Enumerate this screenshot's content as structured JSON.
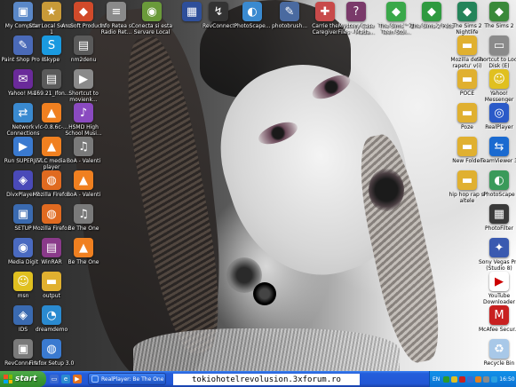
{
  "desktop": {
    "icons": [
      {
        "label": "My Computer",
        "color": "#5a88c8",
        "glyph": "▣"
      },
      {
        "label": "Star Local Server 1",
        "color": "#c89a38",
        "glyph": "★"
      },
      {
        "label": "ArcSoft Products",
        "color": "#d14a2a",
        "glyph": "◆"
      },
      {
        "label": "Info Retea si Radio Ret...",
        "color": "#8a8a8a",
        "glyph": "≡"
      },
      {
        "label": "Conecta si esta Servare Local",
        "color": "#6a9a3a",
        "glyph": "◉"
      },
      {
        "label": "",
        "color": "#2e4f9a",
        "glyph": "▦"
      },
      {
        "label": "RevConnect",
        "color": "#333333",
        "glyph": "↯"
      },
      {
        "label": "PhotoScape...",
        "color": "#3a8ad0",
        "glyph": "◐"
      },
      {
        "label": "photobrush...",
        "color": "#4a6aa0",
        "glyph": "✎"
      },
      {
        "label": "Carrie the Caregiver",
        "color": "#c84a4a",
        "glyph": "✚"
      },
      {
        "label": "Mystery Case Files - Mada...",
        "color": "#7a3a6a",
        "glyph": "?"
      },
      {
        "label": "The Sims™ 2 Teen Stol...",
        "color": "#3aa84a",
        "glyph": "◆"
      },
      {
        "label": "The Sims 2 Pets",
        "color": "#2f9a40",
        "glyph": "◆"
      },
      {
        "label": "The Sims 2 Nightlife",
        "color": "#24845a",
        "glyph": "◆"
      },
      {
        "label": "The Sims 2",
        "color": "#3a8a3a",
        "glyph": "◆"
      },
      {
        "label": "Paint Shop Pro 8",
        "color": "#4a6ab8",
        "glyph": "✎"
      },
      {
        "label": "Skype",
        "color": "#1a9ae0",
        "glyph": "S"
      },
      {
        "label": "nm2denu",
        "color": "#5a5a5a",
        "glyph": "▤"
      },
      {
        "label": "Mozilla de la rapetu' v(i)",
        "color": "#e0b030",
        "glyph": "▬"
      },
      {
        "label": "Shortcut to Local Disk (E)",
        "color": "#8a8a8a",
        "glyph": "▭"
      },
      {
        "label": "Yahoo! Mail",
        "color": "#6a2a9a",
        "glyph": "✉"
      },
      {
        "label": "169.21_Ifon...",
        "color": "#5a5a5a",
        "glyph": "▤"
      },
      {
        "label": "Shortcut to movienk...",
        "color": "#8a8a8a",
        "glyph": "▶"
      },
      {
        "label": "POCE",
        "color": "#e0b030",
        "glyph": "▬"
      },
      {
        "label": "Yahoo! Messenger",
        "color": "#e0c020",
        "glyph": "☺"
      },
      {
        "label": "Network Connections",
        "color": "#3a8ad0",
        "glyph": "⇄"
      },
      {
        "label": "vlc-0.8.6c-...",
        "color": "#f08020",
        "glyph": "▲"
      },
      {
        "label": "HSMD High School Musi...",
        "color": "#8a4ac0",
        "glyph": "♪"
      },
      {
        "label": "Poze",
        "color": "#e0b030",
        "glyph": "▬"
      },
      {
        "label": "RealPlayer",
        "color": "#2a5ac8",
        "glyph": "◎"
      },
      {
        "label": "Run SUPERJET",
        "color": "#3a7ad0",
        "glyph": "▶"
      },
      {
        "label": "VLC media player",
        "color": "#f08020",
        "glyph": "▲"
      },
      {
        "label": "BoA - Valenti",
        "color": "#7a7a7a",
        "glyph": "♫"
      },
      {
        "label": "New Folder",
        "color": "#e0b030",
        "glyph": "▬"
      },
      {
        "label": "TeamViewer 3",
        "color": "#1a6ad0",
        "glyph": "⇆"
      },
      {
        "label": "DivxPlayer 2",
        "color": "#4a4ab8",
        "glyph": "◈"
      },
      {
        "label": "Mozilla Firefox",
        "color": "#e06a20",
        "glyph": "◍"
      },
      {
        "label": "BoA - Valenti",
        "color": "#f08020",
        "glyph": "▲"
      },
      {
        "label": "hip hop rap si altele",
        "color": "#e0b030",
        "glyph": "▬"
      },
      {
        "label": "PhotoScape",
        "color": "#3a9a5a",
        "glyph": "◐"
      },
      {
        "label": "SETUP",
        "color": "#3a6ab0",
        "glyph": "▣"
      },
      {
        "label": "Mozilla Firefox",
        "color": "#e06a20",
        "glyph": "◍"
      },
      {
        "label": "Be The One",
        "color": "#7a7a7a",
        "glyph": "♫"
      },
      {
        "label": "PhotoFilter",
        "color": "#3a3a3a",
        "glyph": "▦"
      },
      {
        "label": "Media Digit",
        "color": "#4a6ac0",
        "glyph": "◉"
      },
      {
        "label": "WinRAR",
        "color": "#8a3a8a",
        "glyph": "▤"
      },
      {
        "label": "Be The One",
        "color": "#f08020",
        "glyph": "▲"
      },
      {
        "label": "Sony Vegas Pro (Studio 8)",
        "color": "#3a5ab0",
        "glyph": "✦"
      },
      {
        "label": "msn",
        "color": "#e0c020",
        "glyph": "☺"
      },
      {
        "label": "output",
        "color": "#e0b030",
        "glyph": "▬"
      },
      {
        "label": "YouTube Downloader",
        "color": "#ffffff",
        "glyph": "▶"
      },
      {
        "label": "IDS",
        "color": "#3a6ab0",
        "glyph": "◈"
      },
      {
        "label": "dreamdemo",
        "color": "#2a8ad0",
        "glyph": "◔"
      },
      {
        "label": "McAfee Secur...",
        "color": "#c82020",
        "glyph": "M"
      },
      {
        "label": "RevConnect...",
        "color": "#7a7a7a",
        "glyph": "▣"
      },
      {
        "label": "Firefox Setup 3.0",
        "color": "#3a7ad0",
        "glyph": "◍"
      },
      {
        "label": "Recycle Bin",
        "color": "#a8c8e8",
        "glyph": "♻"
      }
    ]
  },
  "taskbar": {
    "start_label": "start",
    "quick_launch": [
      {
        "name": "show-desktop-icon",
        "color": "#3a6ad0",
        "glyph": "▭"
      },
      {
        "name": "internet-explorer-icon",
        "color": "#2a8ad0",
        "glyph": "e"
      },
      {
        "name": "media-player-icon",
        "color": "#e07020",
        "glyph": "▶"
      }
    ],
    "task_button_label": "RealPlayer: Be The One",
    "tray": {
      "language": "EN",
      "icons": [
        {
          "color": "#2a9a2a"
        },
        {
          "color": "#e0c020"
        },
        {
          "color": "#c82020"
        },
        {
          "color": "#3a6ad0"
        },
        {
          "color": "#e08020"
        },
        {
          "color": "#8a8a8a"
        },
        {
          "color": "#2aa0e0"
        }
      ],
      "clock": "16:50"
    }
  },
  "watermark": "tokiohotelrevolusion.3xforum.ro"
}
